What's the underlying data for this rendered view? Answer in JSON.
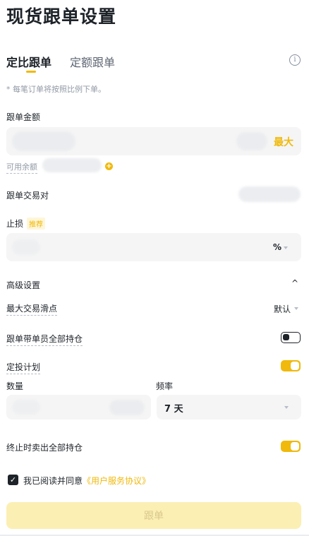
{
  "page": {
    "title": "现货跟单设置"
  },
  "tabs": [
    {
      "label": "定比跟单",
      "active": true
    },
    {
      "label": "定额跟单",
      "active": false
    }
  ],
  "note": "* 每笔订单将按照比例下单。",
  "amount": {
    "label": "跟单金额",
    "max_label": "最大",
    "available_label": "可用余额"
  },
  "pair": {
    "label": "跟单交易对"
  },
  "stop_loss": {
    "label": "止损",
    "badge": "推荐",
    "unit": "%"
  },
  "advanced": {
    "label": "高级设置",
    "slippage_label": "最大交易滑点",
    "slippage_value": "默认",
    "hold_all_label": "跟单带单员全部持仓",
    "hold_all_on": false,
    "dca_label": "定投计划",
    "dca_on": true,
    "quantity_label": "数量",
    "frequency_label": "频率",
    "frequency_value": "7 天",
    "sell_all_label": "终止时卖出全部持仓",
    "sell_all_on": true
  },
  "agreement": {
    "prefix": "我已阅读并同意",
    "link": "《用户服务协议》",
    "checked": true
  },
  "submit_label": "跟单",
  "colors": {
    "accent": "#f0b90b",
    "text": "#1e2329",
    "muted": "#929aa5",
    "field_bg": "#f5f5f5"
  }
}
